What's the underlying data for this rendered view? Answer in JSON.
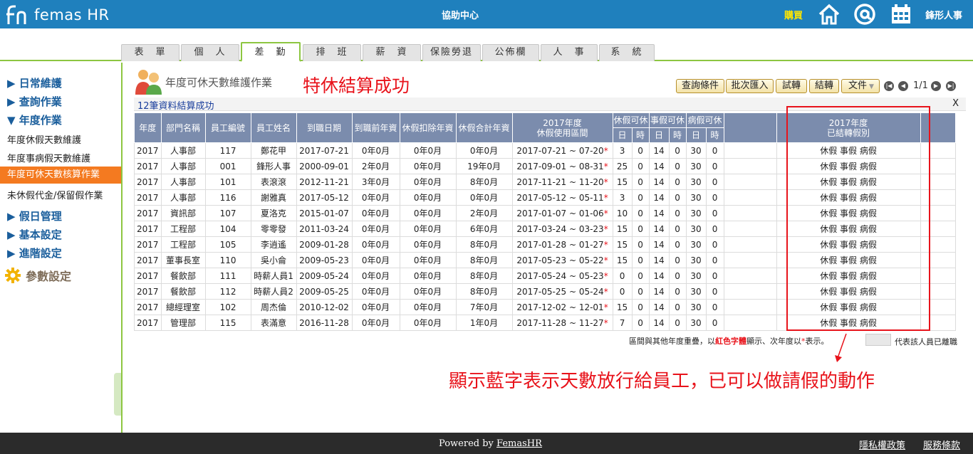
{
  "header": {
    "logo_text": "femas HR",
    "center_title": "協助中心",
    "buy": "購買",
    "company": "鋒形人事"
  },
  "tabs": [
    "表　單",
    "個　人",
    "差　勤",
    "排　班",
    "薪　資",
    "保險勞退",
    "公佈欄",
    "人　事",
    "系　統"
  ],
  "sidebar": {
    "daily": "▶ 日常維護",
    "query": "▶ 查詢作業",
    "yearly": "▼ 年度作業",
    "sub_items": [
      "年度休假天數維護",
      "年度事病假天數維護",
      "年度可休天數核算作業",
      "未休假代金/保留假作業"
    ],
    "holiday": "▶ 假日管理",
    "basic": "▶ 基本設定",
    "advanced": "▶ 進階設定",
    "params": "參數設定"
  },
  "page": {
    "title": "年度可休天數維護作業",
    "annotation_top": "特休結算成功",
    "status": "12筆資料結算成功",
    "close": "X",
    "annotation_bottom": "顯示藍字表示天數放行給員工，已可以做請假的動作"
  },
  "toolbar": {
    "query": "查詢條件",
    "import": "批次匯入",
    "trial": "試轉",
    "settle": "結轉",
    "document": "文件",
    "page": "1/1"
  },
  "table": {
    "headers": {
      "year": "年度",
      "dept": "部門名稱",
      "emp_no": "員工編號",
      "emp_name": "員工姓名",
      "join_date": "到職日期",
      "pre_seniority": "到職前年資",
      "deduct": "休假扣除年資",
      "total": "休假合計年資",
      "period_line1": "2017年度",
      "period_line2": "休假使用區間",
      "annual": "休假可休",
      "personal": "事假可休",
      "sick": "病假可休",
      "day": "日",
      "hour": "時",
      "settled_line1": "2017年度",
      "settled_line2": "已結轉假別"
    },
    "leave_types": "休假 事假 病假",
    "rows": [
      [
        "2017",
        "人事部",
        "117",
        "鄭花甲",
        "2017-07-21",
        "0年0月",
        "0年0月",
        "0年0月",
        "2017-07-21 ~ 07-20",
        "3",
        "0",
        "14",
        "0",
        "30",
        "0"
      ],
      [
        "2017",
        "人事部",
        "001",
        "鋒形人事",
        "2000-09-01",
        "2年0月",
        "0年0月",
        "19年0月",
        "2017-09-01 ~ 08-31",
        "25",
        "0",
        "14",
        "0",
        "30",
        "0"
      ],
      [
        "2017",
        "人事部",
        "101",
        "表滾滾",
        "2012-11-21",
        "3年0月",
        "0年0月",
        "8年0月",
        "2017-11-21 ~ 11-20",
        "15",
        "0",
        "14",
        "0",
        "30",
        "0"
      ],
      [
        "2017",
        "人事部",
        "116",
        "謝雅真",
        "2017-05-12",
        "0年0月",
        "0年0月",
        "0年0月",
        "2017-05-12 ~ 05-11",
        "3",
        "0",
        "14",
        "0",
        "30",
        "0"
      ],
      [
        "2017",
        "資訊部",
        "107",
        "夏洛克",
        "2015-01-07",
        "0年0月",
        "0年0月",
        "2年0月",
        "2017-01-07 ~ 01-06",
        "10",
        "0",
        "14",
        "0",
        "30",
        "0"
      ],
      [
        "2017",
        "工程部",
        "104",
        "零零發",
        "2011-03-24",
        "0年0月",
        "0年0月",
        "6年0月",
        "2017-03-24 ~ 03-23",
        "15",
        "0",
        "14",
        "0",
        "30",
        "0"
      ],
      [
        "2017",
        "工程部",
        "105",
        "李逍遙",
        "2009-01-28",
        "0年0月",
        "0年0月",
        "8年0月",
        "2017-01-28 ~ 01-27",
        "15",
        "0",
        "14",
        "0",
        "30",
        "0"
      ],
      [
        "2017",
        "董事長室",
        "110",
        "吳小侖",
        "2009-05-23",
        "0年0月",
        "0年0月",
        "8年0月",
        "2017-05-23 ~ 05-22",
        "15",
        "0",
        "14",
        "0",
        "30",
        "0"
      ],
      [
        "2017",
        "餐飲部",
        "111",
        "時薪人員1",
        "2009-05-24",
        "0年0月",
        "0年0月",
        "8年0月",
        "2017-05-24 ~ 05-23",
        "0",
        "0",
        "14",
        "0",
        "30",
        "0"
      ],
      [
        "2017",
        "餐飲部",
        "112",
        "時薪人員2",
        "2009-05-25",
        "0年0月",
        "0年0月",
        "8年0月",
        "2017-05-25 ~ 05-24",
        "0",
        "0",
        "14",
        "0",
        "30",
        "0"
      ],
      [
        "2017",
        "總經理室",
        "102",
        "周杰倫",
        "2010-12-02",
        "0年0月",
        "0年0月",
        "7年0月",
        "2017-12-02 ~ 12-01",
        "15",
        "0",
        "14",
        "0",
        "30",
        "0"
      ],
      [
        "2017",
        "管理部",
        "115",
        "表滿意",
        "2016-11-28",
        "0年0月",
        "0年0月",
        "1年0月",
        "2017-11-28 ~ 11-27",
        "7",
        "0",
        "14",
        "0",
        "30",
        "0"
      ]
    ]
  },
  "legend": {
    "part1": "區間與其他年度重疊，以",
    "red_text": "紅色字體",
    "part2": "顯示、次年度以",
    "star": "*",
    "part3": "表示。",
    "resigned": "代表該人員已離職"
  },
  "footer": {
    "powered": "Powered by ",
    "brand": "FemasHR",
    "privacy": "隱私權政策",
    "terms": "服務條款"
  },
  "colors": {
    "header_blue": "#1f80bd",
    "green_accent": "#8dc641",
    "orange_active": "#f47a20",
    "annotation_red": "#e8131b",
    "table_header": "#7b8cad",
    "leave_link_blue": "#1a3eb0"
  }
}
